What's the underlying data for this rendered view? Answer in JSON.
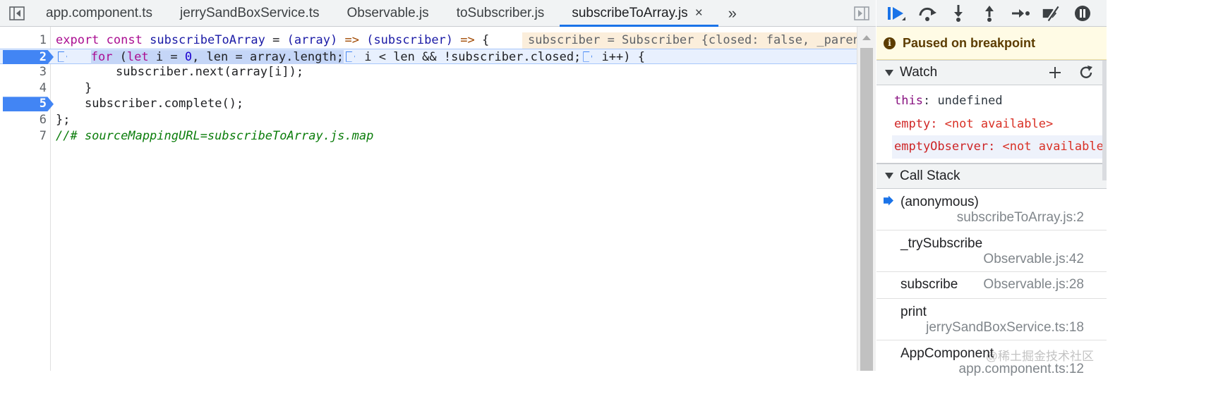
{
  "tabs": [
    {
      "label": "app.component.ts"
    },
    {
      "label": "jerrySandBoxService.ts"
    },
    {
      "label": "Observable.js"
    },
    {
      "label": "toSubscriber.js"
    },
    {
      "label": "subscribeToArray.js",
      "active": true
    }
  ],
  "tab_close_label": "×",
  "tab_more_label": "»",
  "code": {
    "line_numbers": [
      "1",
      "2",
      "3",
      "4",
      "5",
      "6",
      "7"
    ],
    "line1": {
      "export": "export",
      "const": "const",
      "name": "subscribeToArray",
      "eq": " = ",
      "arr": "(array) ",
      "arrow1": "=>",
      "sub": " (subscriber) ",
      "arrow2": "=>",
      "brace": " {"
    },
    "line1_inline_value": "subscriber = Subscriber {closed: false, _parentOrParents: null, _subscriptions: null, syncErrorValue: null}",
    "line2": {
      "for": "for",
      "open": " (",
      "let": "let",
      "init": " i = ",
      "zero": "0",
      "len": ", len = array.length;",
      "cond": " i < len && !subscriber.closed;",
      "inc": " i++) {"
    },
    "line3": "subscriber.next(array[i]);",
    "line4": "}",
    "line5": "subscriber.complete();",
    "line6": "};",
    "line7": "//# sourceMappingURL=subscribeToArray.js.map"
  },
  "debugger": {
    "paused_text": "Paused on breakpoint",
    "watch_title": "Watch",
    "watch": [
      {
        "name": "this",
        "value": "undefined",
        "error": false
      },
      {
        "name": "empty",
        "value": "<not available>",
        "error": true
      },
      {
        "name": "emptyObserver",
        "value": "<not available>",
        "error": true
      }
    ],
    "callstack_title": "Call Stack",
    "frames": [
      {
        "name": "(anonymous)",
        "location": "subscribeToArray.js:2",
        "current": true
      },
      {
        "name": "_trySubscribe",
        "location": "Observable.js:42"
      },
      {
        "name": "subscribe",
        "location": "Observable.js:28"
      },
      {
        "name": "print",
        "location": "jerrySandBoxService.ts:18"
      },
      {
        "name": "AppComponent",
        "location": "app.component.ts:12"
      }
    ]
  },
  "watermark": "@稀土掘金技术社区",
  "colors": {
    "accent": "#1a73e8",
    "breakpoint": "#4285f4",
    "paused_bg": "#fffbe5"
  }
}
